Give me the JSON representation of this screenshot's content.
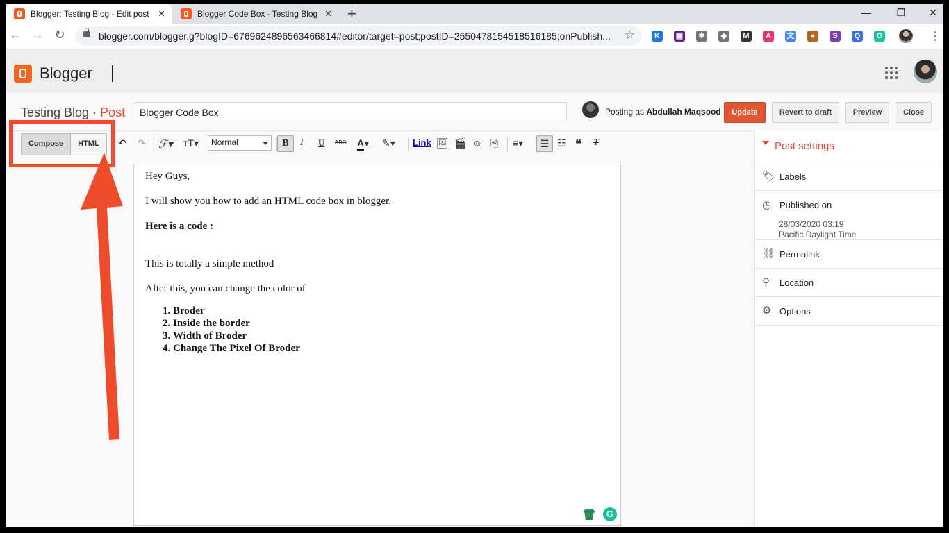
{
  "browser": {
    "tabs": [
      {
        "title": "Blogger: Testing Blog - Edit post",
        "close": "✕"
      },
      {
        "title": "Blogger Code Box - Testing Blog",
        "close": "✕"
      }
    ],
    "new_tab": "+",
    "window_controls": {
      "minimize": "—",
      "restore": "❐",
      "close": "✕"
    },
    "url": "blogger.com/blogger.g?blogID=6769624896563466814#editor/target=post;postID=2550478154518516185;onPublish...",
    "extensions": [
      {
        "name": "k-icon",
        "label": "K",
        "color": "#1a73e8"
      },
      {
        "name": "screen-icon",
        "label": "▣",
        "color": "#6a1b9a"
      },
      {
        "name": "gear-ext-icon",
        "label": "✱",
        "color": "#757575"
      },
      {
        "name": "puzzle-icon",
        "label": "◆",
        "color": "#757575"
      },
      {
        "name": "m-icon",
        "label": "M",
        "color": "#333333"
      },
      {
        "name": "a-icon",
        "label": "A",
        "color": "#e8336d"
      },
      {
        "name": "translate-icon",
        "label": "文",
        "color": "#4285f4"
      },
      {
        "name": "cookie-icon",
        "label": "●",
        "color": "#b5651d"
      },
      {
        "name": "s-icon",
        "label": "S",
        "color": "#7b3fb5"
      },
      {
        "name": "q-icon",
        "label": "Q",
        "color": "#3a6ee8"
      },
      {
        "name": "grammarly-ext-icon",
        "label": "G",
        "color": "#15c39a"
      }
    ]
  },
  "blogger": {
    "app_name": "Blogger",
    "blog_title": "Testing Blog · ",
    "section": "Post",
    "post_title": "Blogger Code Box",
    "posting_as_prefix": "Posting as ",
    "posting_as_user": "Abdullah Maqsood",
    "buttons": {
      "update": "Update",
      "revert": "Revert to draft",
      "preview": "Preview",
      "close": "Close"
    }
  },
  "toolbar": {
    "compose": "Compose",
    "html": "HTML",
    "format": "Normal",
    "bold": "B",
    "italic": "I",
    "underline": "U",
    "strike": "ABC",
    "link": "Link"
  },
  "editor": {
    "greeting": "Hey Guys,",
    "intro": "I will show you how to add an HTML code box in blogger.",
    "code_heading": "Here is a code :",
    "simple": "This is totally a simple method",
    "after": "After this, you can change the color of",
    "list": [
      "Broder",
      "Inside the border",
      "Width of Broder",
      "Change The Pixel Of Broder"
    ]
  },
  "sidebar": {
    "title": "Post settings",
    "labels": "Labels",
    "published_on": "Published on",
    "published_date": "28/03/2020 03:19",
    "timezone": "Pacific Daylight Time",
    "permalink": "Permalink",
    "location": "Location",
    "options": "Options"
  },
  "colors": {
    "accent": "#dd4b39",
    "update_button": "#dd5833",
    "annotation": "#ee4b2b"
  }
}
